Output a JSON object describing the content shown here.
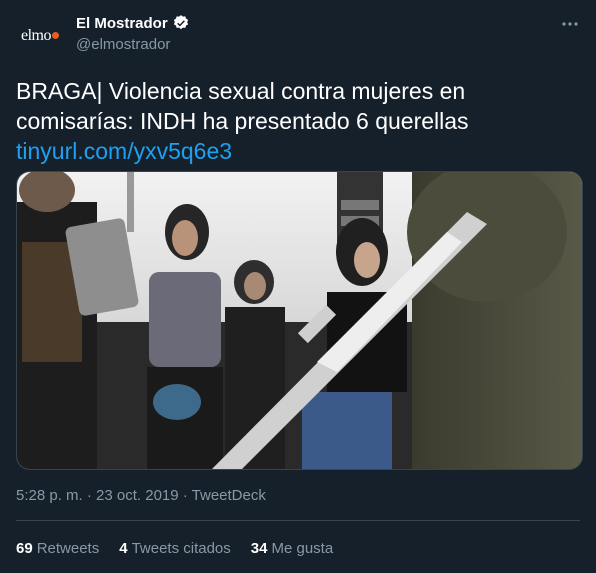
{
  "account": {
    "avatar_text": "elmo",
    "display_name": "El Mostrador",
    "handle": "@elmostrador",
    "avatar_accent": "#e85d24",
    "verified_icon": "verified-badge-icon"
  },
  "tweet": {
    "text": "BRAGA| Violencia sexual contra mujeres en comisarías: INDH ha presentado 6 querellas",
    "link": "tinyurl.com/yxv5q6e3",
    "timestamp": "5:28 p. m. · 23 oct. 2019 · TweetDeck"
  },
  "stats": {
    "retweets_count": "69",
    "retweets_label": "Retweets",
    "quotes_count": "4",
    "quotes_label": "Tweets citados",
    "likes_count": "34",
    "likes_label": "Me gusta"
  },
  "colors": {
    "background": "#15202b",
    "link": "#1da1f2",
    "muted": "#8899a6",
    "border": "#38444d"
  }
}
